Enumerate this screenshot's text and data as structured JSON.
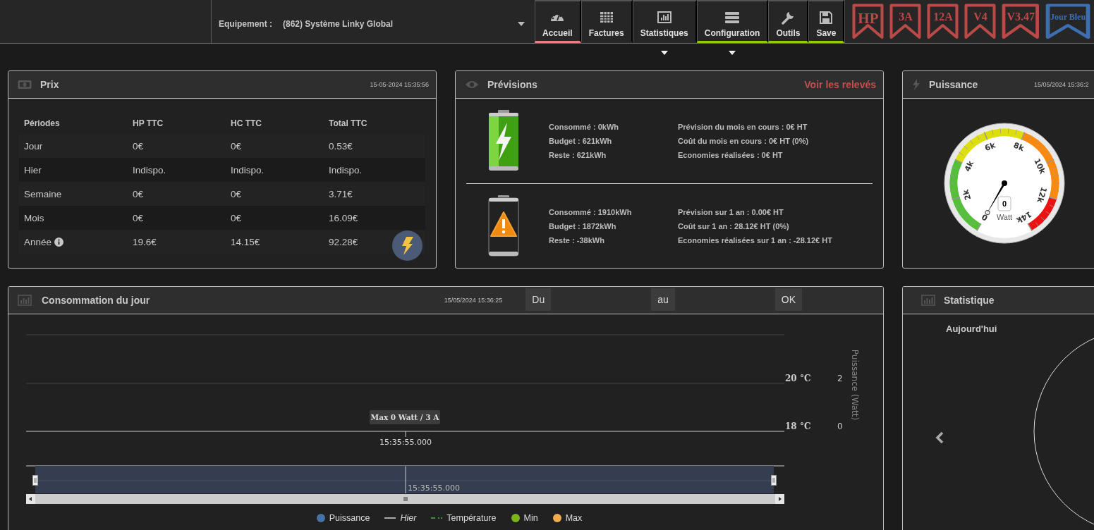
{
  "header": {
    "equipment_label": "Equipement :",
    "equipment_value": "(862) Système Linky Global",
    "nav": [
      {
        "label": "Accueil",
        "kind": "gauge",
        "selected": true,
        "marked": false,
        "has_menu": false
      },
      {
        "label": "Factures",
        "kind": "table",
        "selected": false,
        "marked": false,
        "has_menu": false
      },
      {
        "label": "Statistiques",
        "kind": "bars",
        "selected": false,
        "marked": false,
        "has_menu": true
      },
      {
        "label": "Configuration",
        "kind": "server",
        "selected": false,
        "marked": true,
        "has_menu": true
      },
      {
        "label": "Outils",
        "kind": "wrench",
        "selected": false,
        "marked": true,
        "has_menu": false
      },
      {
        "label": "Save",
        "kind": "floppy",
        "selected": false,
        "marked": true,
        "has_menu": false
      }
    ],
    "badges": [
      {
        "text": "HP",
        "color": "#b94a48"
      },
      {
        "text": "3A",
        "color": "#b94a48"
      },
      {
        "text": "12A",
        "color": "#b94a48"
      },
      {
        "text": "V4",
        "color": "#b94a48"
      },
      {
        "text": "V3.47",
        "color": "#b94a48"
      },
      {
        "text": "Jour Bleu",
        "color": "#3d6fb0"
      }
    ]
  },
  "prix": {
    "title": "Prix",
    "timestamp": "15-05-2024 15:35:56",
    "columns": [
      "Périodes",
      "HP TTC",
      "HC TTC",
      "Total TTC"
    ],
    "rows": [
      {
        "cells": [
          "Jour",
          "0€",
          "0€",
          "0.53€"
        ],
        "info": false
      },
      {
        "cells": [
          "Hier",
          "Indispo.",
          "Indispo.",
          "Indispo."
        ],
        "info": false
      },
      {
        "cells": [
          "Semaine",
          "0€",
          "0€",
          "3.71€"
        ],
        "info": false
      },
      {
        "cells": [
          "Mois",
          "0€",
          "0€",
          "16.09€"
        ],
        "info": false
      },
      {
        "cells": [
          "Année",
          "19.6€",
          "14.15€",
          "92.28€"
        ],
        "info": true
      }
    ]
  },
  "previsions": {
    "title": "Prévisions",
    "link": "Voir les relevés",
    "blocks": [
      {
        "kind": "ok",
        "left": [
          "Consommé : 0kWh",
          "Budget : 621kWh",
          "Reste : 621kWh"
        ],
        "right": [
          "Prévision du mois en cours : 0€ HT",
          "Coût du mois en cours : 0€ HT (0%)",
          "Economies réalisées : 0€ HT"
        ]
      },
      {
        "kind": "warning",
        "left": [
          "Consommé : 1910kWh",
          "Budget : 1872kWh",
          "Reste : -38kWh"
        ],
        "right": [
          "Prévision sur 1 an : 0.00€ HT",
          "Coût sur 1 an : 28.12€ HT (0%)",
          "Economies réalisées sur 1 an : -28.12€ HT"
        ]
      }
    ]
  },
  "puissance": {
    "title": "Puissance",
    "timestamp": "15/05/2024 15:36:2",
    "gauge": {
      "ticks": [
        "0",
        "2k",
        "4k",
        "6k",
        "8k",
        "10k",
        "12k",
        "14k"
      ],
      "value": "0",
      "unit": "Watt"
    }
  },
  "conso": {
    "title": "Consommation du jour",
    "timestamp": "15/05/2024 15:36:25",
    "buttons": [
      "Du",
      "au",
      "OK"
    ],
    "chart": {
      "temp_labels": [
        "20 °C",
        "18 °C"
      ],
      "power_labels": [
        "2",
        "0"
      ],
      "axis_title": "Puissance (Watt)",
      "tooltip": "Max 0 Watt / 3 A",
      "x_label": "15:35:55.000",
      "navigator_label": "15:35:55.000"
    },
    "legend": [
      {
        "label": "Puissance",
        "kind": "dot",
        "color": "#4572a7"
      },
      {
        "label": "Hier",
        "kind": "line",
        "color": "#aaaaaa"
      },
      {
        "label": "Température",
        "kind": "dash",
        "color": "#2e9e2e"
      },
      {
        "label": "Min",
        "kind": "dot",
        "color": "#7cb518"
      },
      {
        "label": "Max",
        "kind": "dot",
        "color": "#f0ad4e"
      }
    ]
  },
  "statistique": {
    "title": "Statistique",
    "period": "Aujourd'hui"
  }
}
